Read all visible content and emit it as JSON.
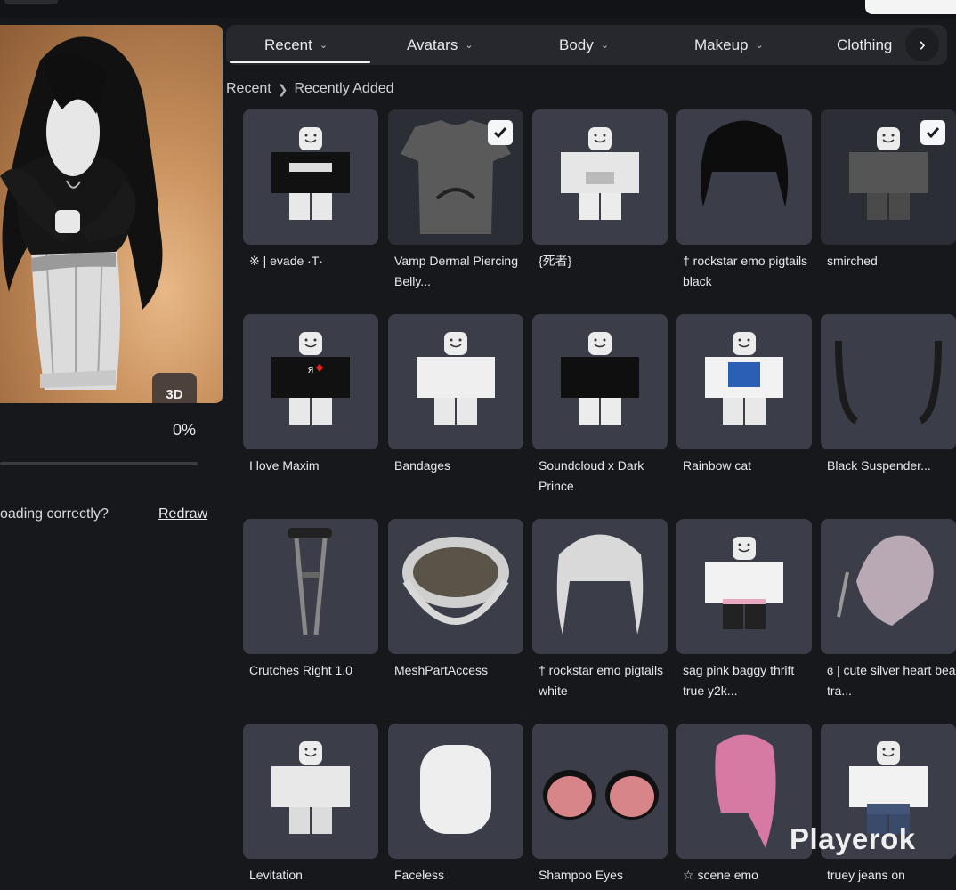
{
  "avatar": {
    "view_toggle": "3D"
  },
  "progress": {
    "value_percent": 0,
    "label": "0%"
  },
  "loading": {
    "question": "oading correctly?",
    "redraw": "Redraw"
  },
  "tabs": [
    {
      "label": "Recent",
      "active": true
    },
    {
      "label": "Avatars"
    },
    {
      "label": "Body"
    },
    {
      "label": "Makeup"
    },
    {
      "label": "Clothing"
    }
  ],
  "breadcrumb": {
    "root": "Recent",
    "current": "Recently Added"
  },
  "items": [
    {
      "name": "※ | evade ·T·",
      "thumb": "figure-black-top",
      "selected": false
    },
    {
      "name": "Vamp Dermal Piercing Belly...",
      "thumb": "grey-tshirt",
      "selected": true
    },
    {
      "name": "{死者}",
      "thumb": "figure-white-corset",
      "selected": false
    },
    {
      "name": "† rockstar emo pigtails black",
      "thumb": "black-hair",
      "selected": false
    },
    {
      "name": "smirched",
      "thumb": "figure-grey",
      "selected": true
    },
    {
      "name": "I love Maxim",
      "thumb": "figure-love-shirt",
      "selected": false
    },
    {
      "name": "Bandages",
      "thumb": "figure-white",
      "selected": false
    },
    {
      "name": "Soundcloud x Dark Prince",
      "thumb": "figure-black",
      "selected": false
    },
    {
      "name": "Rainbow cat",
      "thumb": "figure-nyan",
      "selected": false
    },
    {
      "name": "Black Suspender...",
      "thumb": "suspenders",
      "selected": false
    },
    {
      "name": "Crutches Right 1.0",
      "thumb": "crutch",
      "selected": false
    },
    {
      "name": "MeshPartAccess",
      "thumb": "teeth",
      "selected": false
    },
    {
      "name": "† rockstar emo pigtails white",
      "thumb": "white-hair",
      "selected": false
    },
    {
      "name": "sag pink baggy thrift true y2k...",
      "thumb": "figure-baggy",
      "selected": false
    },
    {
      "name": "ɞ | cute silver heart bear tra...",
      "thumb": "heart-bear",
      "selected": false
    },
    {
      "name": "Levitation",
      "thumb": "figure-levitate",
      "selected": false
    },
    {
      "name": "Faceless",
      "thumb": "head",
      "selected": false
    },
    {
      "name": "Shampoo Eyes",
      "thumb": "eyes",
      "selected": false
    },
    {
      "name": "☆ scene emo",
      "thumb": "pink-hair",
      "selected": false
    },
    {
      "name": "truey jeans on",
      "thumb": "figure-jeans",
      "selected": false
    }
  ],
  "watermark": "Playerok",
  "colors": {
    "background": "#17181c",
    "card": "#3b3e48",
    "tab_bar": "#26282d",
    "avatar_bg": "#c9925f"
  }
}
